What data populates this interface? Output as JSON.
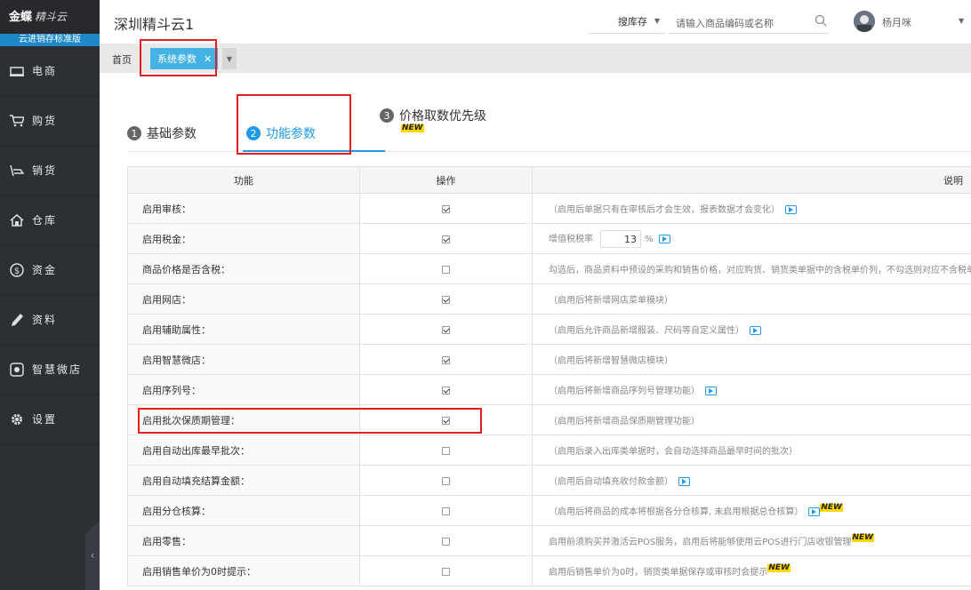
{
  "app": {
    "brand": "金蝶",
    "brand_sub": "精斗云",
    "edition": "云进销存标准版",
    "company": "深圳精斗云1"
  },
  "sidebar": {
    "items": [
      {
        "label": "电商",
        "icon": "shop-icon"
      },
      {
        "label": "购货",
        "icon": "cart-icon"
      },
      {
        "label": "销货",
        "icon": "sell-icon"
      },
      {
        "label": "仓库",
        "icon": "warehouse-icon"
      },
      {
        "label": "资金",
        "icon": "money-icon"
      },
      {
        "label": "资料",
        "icon": "pen-icon"
      },
      {
        "label": "智慧微店",
        "icon": "store-icon"
      },
      {
        "label": "设置",
        "icon": "gear-icon"
      }
    ]
  },
  "header": {
    "search_scope": "搜库存",
    "search_placeholder": "请输入商品编码或名称",
    "user_name": "杨月咪"
  },
  "tabs": {
    "home": "首页",
    "active": "系统参数",
    "close": "✕"
  },
  "steps": [
    {
      "num": "1",
      "label": "基础参数"
    },
    {
      "num": "2",
      "label": "功能参数"
    },
    {
      "num": "3",
      "label": "价格取数优先级",
      "badge": "NEW"
    }
  ],
  "table": {
    "headers": {
      "feature": "功能",
      "operation": "操作",
      "description": "说明"
    },
    "rate_label": "增值税税率",
    "rate_value": "13",
    "rate_unit": "%",
    "new_badge": "NEW",
    "rows": [
      {
        "feature": "启用审核：",
        "checked": true,
        "desc": "（启用后单据只有在审核后才会生效，报表数据才会变化）"
      },
      {
        "feature": "启用税金：",
        "checked": true,
        "desc": ""
      },
      {
        "feature": "商品价格是否含税：",
        "checked": false,
        "desc": "勾选后，商品资料中预设的采购和销售价格，对应购货、销货类单据中的含税单价列，不勾选则对应不含税单价列"
      },
      {
        "feature": "启用网店：",
        "checked": true,
        "desc": "（启用后将新增网店菜单模块）"
      },
      {
        "feature": "启用辅助属性：",
        "checked": true,
        "desc": "（启用后允许商品新增服装、尺码等自定义属性）"
      },
      {
        "feature": "启用智慧微店：",
        "checked": true,
        "desc": "（启用后将新增智慧微店模块）"
      },
      {
        "feature": "启用序列号：",
        "checked": true,
        "desc": "（启用后将新增商品序列号管理功能）"
      },
      {
        "feature": "启用批次保质期管理：",
        "checked": true,
        "desc": "（启用后将新增商品保质期管理功能）"
      },
      {
        "feature": "启用自动出库最早批次：",
        "checked": false,
        "desc": "（启用后录入出库类单据时，会自动选择商品最早时间的批次）"
      },
      {
        "feature": "启用自动填充结算金额：",
        "checked": false,
        "desc": "（启用后自动填充收付款金额）"
      },
      {
        "feature": "启用分仓核算：",
        "checked": false,
        "desc": "（启用后将商品的成本将根据各分仓核算, 未启用根据总仓核算）"
      },
      {
        "feature": "启用零售：",
        "checked": false,
        "desc": "启用前须购买并激活云POS服务，启用后将能够使用云POS进行门店收银管理"
      },
      {
        "feature": "启用销售单价为0时提示：",
        "checked": false,
        "desc": "启用后销售单价为0时，销货类单据保存或审核时会提示"
      }
    ]
  }
}
